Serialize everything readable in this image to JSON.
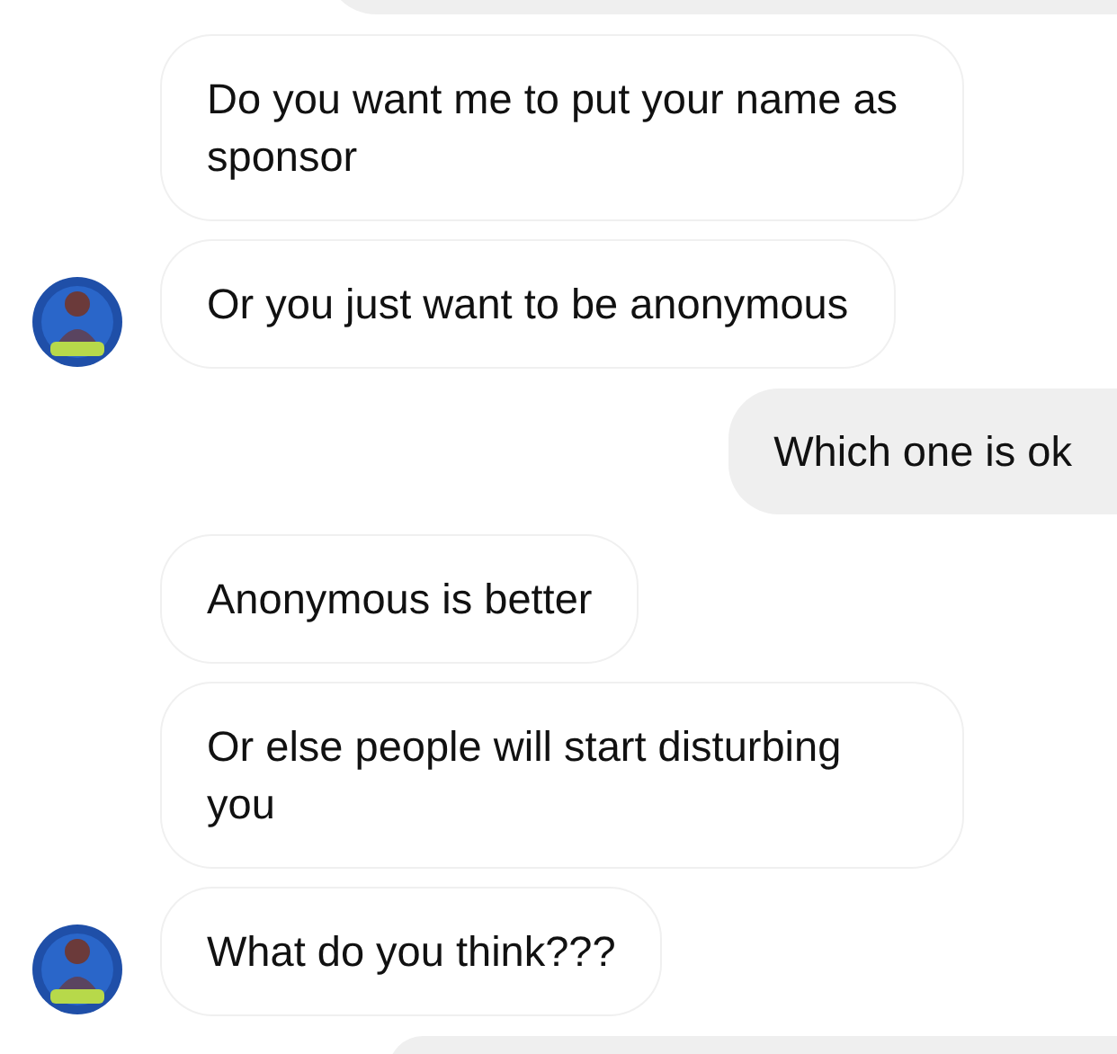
{
  "messages": [
    {
      "kind": "outgoing",
      "partial": true
    },
    {
      "kind": "incoming",
      "text": "Do you want me to put your name as sponsor",
      "avatar": false
    },
    {
      "kind": "incoming",
      "text": "Or you just want to be anonymous",
      "avatar": true
    },
    {
      "kind": "outgoing",
      "text": "Which one is ok"
    },
    {
      "kind": "incoming",
      "text": "Anonymous is better",
      "avatar": false
    },
    {
      "kind": "incoming",
      "text": "Or else people will start disturbing you",
      "avatar": false
    },
    {
      "kind": "incoming",
      "text": "What do you think???",
      "avatar": true
    },
    {
      "kind": "outgoing",
      "partial": true
    }
  ]
}
